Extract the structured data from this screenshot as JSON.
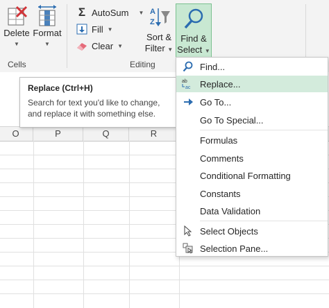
{
  "ribbon": {
    "cells": {
      "delete_label": "Delete",
      "format_label": "Format",
      "group_label": "Cells"
    },
    "editing": {
      "autosum_label": "AutoSum",
      "fill_label": "Fill",
      "clear_label": "Clear",
      "sort_filter_label_1": "Sort &",
      "sort_filter_label_2": "Filter",
      "find_select_label_1": "Find &",
      "find_select_label_2": "Select",
      "group_label": "Editing"
    }
  },
  "tooltip": {
    "title": "Replace (Ctrl+H)",
    "description": "Search for text you'd like to change, and replace it with something else."
  },
  "grid": {
    "columns": [
      "O",
      "P",
      "Q",
      "R"
    ]
  },
  "menu": {
    "items": [
      {
        "label": "Find...",
        "icon": "search-icon"
      },
      {
        "label": "Replace...",
        "icon": "replace-icon",
        "state": "hover"
      },
      {
        "label": "Go To...",
        "icon": "arrow-right-icon"
      },
      {
        "label": "Go To Special...",
        "icon": ""
      },
      {
        "label": "Formulas",
        "icon": ""
      },
      {
        "label": "Comments",
        "icon": ""
      },
      {
        "label": "Conditional Formatting",
        "icon": ""
      },
      {
        "label": "Constants",
        "icon": ""
      },
      {
        "label": "Data Validation",
        "icon": ""
      },
      {
        "label": "Select Objects",
        "icon": "cursor-icon"
      },
      {
        "label": "Selection Pane...",
        "icon": "selection-pane-icon"
      }
    ]
  },
  "colors": {
    "accent_green": "#c8e8d2",
    "hover_green": "#d3ebdc",
    "icon_blue": "#2b6cb0",
    "eraser_pink": "#e56b7a"
  }
}
